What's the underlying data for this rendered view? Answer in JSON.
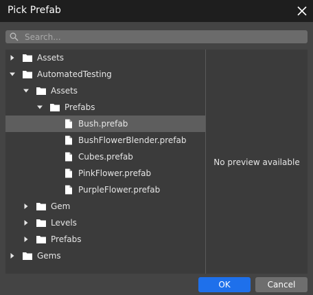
{
  "window": {
    "title": "Pick Prefab"
  },
  "search": {
    "placeholder": "Search..."
  },
  "tree": {
    "items": [
      {
        "label": "Assets",
        "type": "folder",
        "depth": 0,
        "state": "collapsed"
      },
      {
        "label": "AutomatedTesting",
        "type": "folder",
        "depth": 0,
        "state": "expanded"
      },
      {
        "label": "Assets",
        "type": "folder",
        "depth": 1,
        "state": "expanded"
      },
      {
        "label": "Prefabs",
        "type": "folder",
        "depth": 2,
        "state": "expanded"
      },
      {
        "label": "Bush.prefab",
        "type": "file",
        "depth": 3,
        "state": "leaf",
        "selected": true
      },
      {
        "label": "BushFlowerBlender.prefab",
        "type": "file",
        "depth": 3,
        "state": "leaf"
      },
      {
        "label": "Cubes.prefab",
        "type": "file",
        "depth": 3,
        "state": "leaf"
      },
      {
        "label": "PinkFlower.prefab",
        "type": "file",
        "depth": 3,
        "state": "leaf"
      },
      {
        "label": "PurpleFlower.prefab",
        "type": "file",
        "depth": 3,
        "state": "leaf"
      },
      {
        "label": "Gem",
        "type": "folder",
        "depth": 1,
        "state": "collapsed"
      },
      {
        "label": "Levels",
        "type": "folder",
        "depth": 1,
        "state": "collapsed"
      },
      {
        "label": "Prefabs",
        "type": "folder",
        "depth": 1,
        "state": "collapsed"
      },
      {
        "label": "Gems",
        "type": "folder",
        "depth": 0,
        "state": "collapsed"
      }
    ]
  },
  "preview": {
    "message": "No preview available"
  },
  "buttons": {
    "ok": "OK",
    "cancel": "Cancel"
  },
  "icons": {
    "close": "close-icon",
    "search": "search-icon",
    "folder": "folder-icon",
    "file": "file-icon"
  },
  "colors": {
    "accent": "#1e70eb",
    "selection": "#5e5e5e",
    "background": "#444444",
    "panel": "#3b3b3b"
  }
}
